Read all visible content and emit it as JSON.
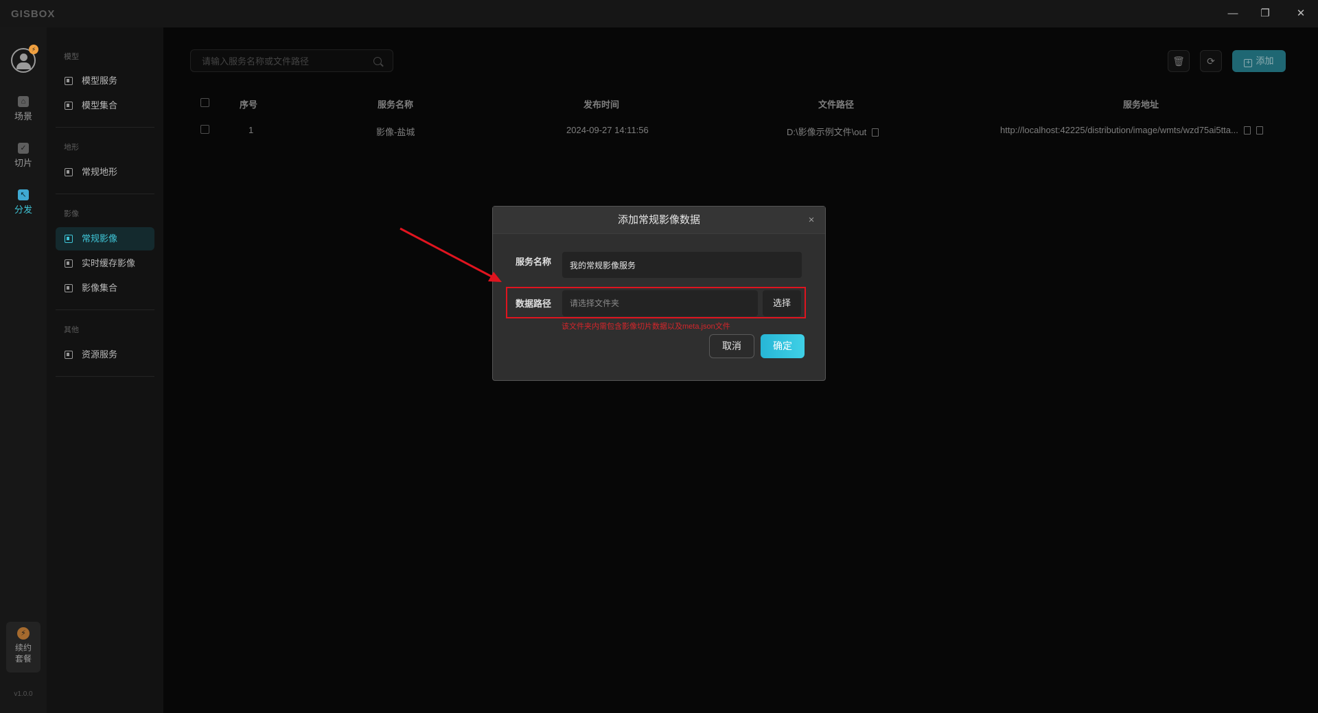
{
  "app": {
    "logo": "GISBOX",
    "version": "v1.0.0"
  },
  "window_controls": {
    "minimize": "—",
    "restore": "❐",
    "close": "✕"
  },
  "rail": {
    "items": [
      {
        "label": "场景",
        "icon": "home-icon"
      },
      {
        "label": "切片",
        "icon": "check-document-icon"
      },
      {
        "label": "分发",
        "icon": "distribute-icon",
        "active": true
      }
    ],
    "renew_label_1": "续约",
    "renew_label_2": "套餐",
    "badge": "⚡"
  },
  "subnav": {
    "sections": {
      "model": "模型",
      "terrain": "地形",
      "imagery": "影像",
      "other": "其他"
    },
    "items": {
      "model_service": "模型服务",
      "model_collection": "模型集合",
      "regular_terrain": "常规地形",
      "regular_imagery": "常规影像",
      "realtime_cache_imagery": "实时缓存影像",
      "imagery_collection": "影像集合",
      "resource_service": "资源服务"
    }
  },
  "toolbar": {
    "search_placeholder": "请输入服务名称或文件路径",
    "add_label": "添加",
    "accent_color": "#2a8a9a"
  },
  "table": {
    "headers": {
      "index": "序号",
      "name": "服务名称",
      "time": "发布时间",
      "path": "文件路径",
      "url": "服务地址"
    },
    "rows": [
      {
        "index": "1",
        "name": "影像-盐城",
        "time": "2024-09-27 14:11:56",
        "path": "D:\\影像示例文件\\out",
        "url": "http://localhost:42225/distribution/image/wmts/wzd75ai5tta..."
      }
    ]
  },
  "modal": {
    "title": "添加常规影像数据",
    "close": "×",
    "service_name_label": "服务名称",
    "service_name_value": "我的常规影像服务",
    "data_path_label": "数据路径",
    "data_path_placeholder": "请选择文件夹",
    "pick_label": "选择",
    "hint": "该文件夹内需包含影像切片数据以及meta.json文件",
    "cancel_label": "取消",
    "ok_label": "确定",
    "highlight_color": "#e0141f"
  }
}
